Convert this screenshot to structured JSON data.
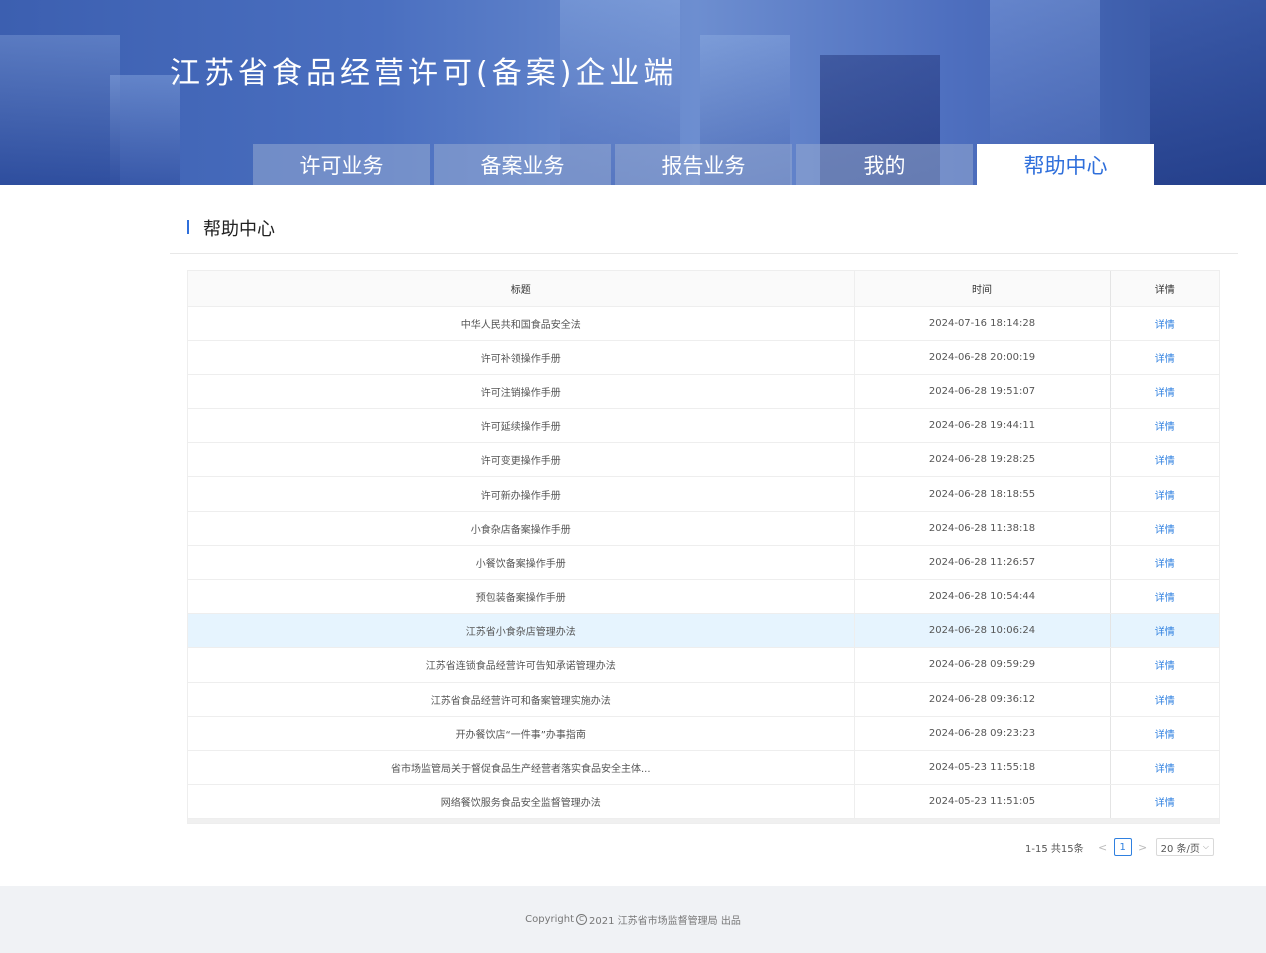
{
  "header": {
    "title": "江苏省食品经营许可(备案)企业端",
    "tabs": [
      {
        "label": "许可业务"
      },
      {
        "label": "备案业务"
      },
      {
        "label": "报告业务"
      },
      {
        "label": "我的"
      },
      {
        "label": "帮助中心"
      }
    ],
    "active_tab": "帮助中心"
  },
  "section": {
    "title": "帮助中心"
  },
  "table": {
    "headers": {
      "title": "标题",
      "time": "时间",
      "detail": "详情"
    },
    "rows": [
      {
        "title": "中华人民共和国食品安全法",
        "time": "2024-07-16 18:14:28",
        "detail": "详情"
      },
      {
        "title": "许可补领操作手册",
        "time": "2024-06-28 20:00:19",
        "detail": "详情"
      },
      {
        "title": "许可注销操作手册",
        "time": "2024-06-28 19:51:07",
        "detail": "详情"
      },
      {
        "title": "许可延续操作手册",
        "time": "2024-06-28 19:44:11",
        "detail": "详情"
      },
      {
        "title": "许可变更操作手册",
        "time": "2024-06-28 19:28:25",
        "detail": "详情"
      },
      {
        "title": "许可新办操作手册",
        "time": "2024-06-28 18:18:55",
        "detail": "详情"
      },
      {
        "title": "小食杂店备案操作手册",
        "time": "2024-06-28 11:38:18",
        "detail": "详情"
      },
      {
        "title": "小餐饮备案操作手册",
        "time": "2024-06-28 11:26:57",
        "detail": "详情"
      },
      {
        "title": "预包装备案操作手册",
        "time": "2024-06-28 10:54:44",
        "detail": "详情"
      },
      {
        "title": "江苏省小食杂店管理办法",
        "time": "2024-06-28 10:06:24",
        "detail": "详情"
      },
      {
        "title": "江苏省连锁食品经营许可告知承诺管理办法",
        "time": "2024-06-28 09:59:29",
        "detail": "详情"
      },
      {
        "title": "江苏省食品经营许可和备案管理实施办法",
        "time": "2024-06-28 09:36:12",
        "detail": "详情"
      },
      {
        "title": "开办餐饮店“一件事”办事指南",
        "time": "2024-06-28 09:23:23",
        "detail": "详情"
      },
      {
        "title": "省市场监管局关于督促食品生产经营者落实食品安全主体...",
        "time": "2024-05-23 11:55:18",
        "detail": "详情"
      },
      {
        "title": "网络餐饮服务食品安全监督管理办法",
        "time": "2024-05-23 11:51:05",
        "detail": "详情"
      }
    ],
    "highlight_row_index": 9
  },
  "pagination": {
    "total_text": "1-15 共15条",
    "prev": "<",
    "current_page": "1",
    "next": ">",
    "page_size": "20 条/页"
  },
  "footer": {
    "prefix": "Copyright",
    "copyright_symbol": "C",
    "text": "2021 江苏省市场监督管理局 出品"
  }
}
